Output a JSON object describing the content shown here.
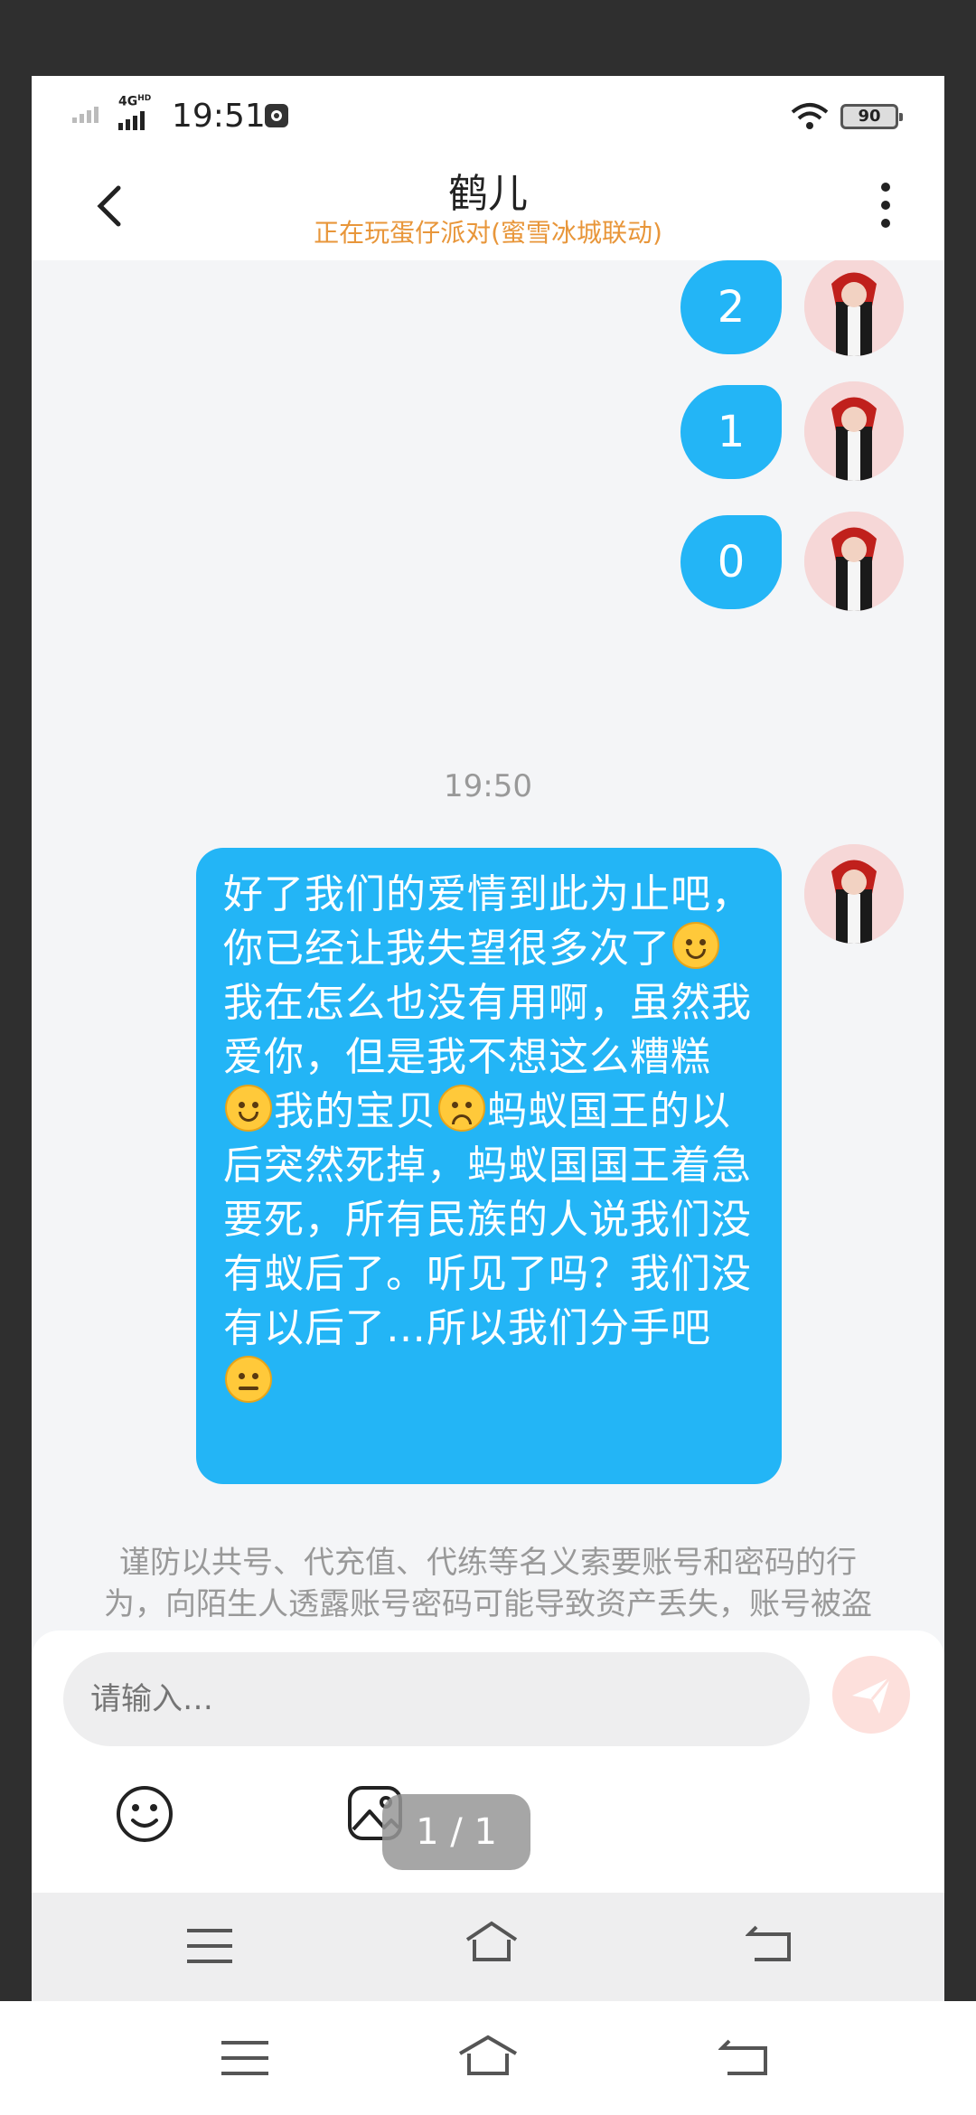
{
  "status_bar": {
    "network": "4G",
    "network_sub": "HD",
    "time": "19:51",
    "battery": "90"
  },
  "header": {
    "title": "鹤儿",
    "subtitle": "正在玩蛋仔派对(蜜雪冰城联动)"
  },
  "messages": {
    "count_msgs": [
      "2",
      "1",
      "0"
    ],
    "time_label": "19:50",
    "long_message_parts": [
      "好了我们的爱情到此为止吧，你已经让我失望很多次了",
      "我在怎么也没有用啊，虽然我爱你，但是我不想这么糟糕",
      "我的宝贝",
      "蚂蚁国王的以后突然死掉，蚂蚁国国王着急要死，所有民族的人说我们没有蚁后了。听见了吗？我们没有以后了…所以我们分手吧"
    ],
    "emojis": [
      "smile-emoji",
      "smile-emoji",
      "sad-emoji",
      "neutral-emoji"
    ]
  },
  "warning": "谨防以共号、代充值、代练等名义索要账号和密码的行为，向陌生人透露账号密码可能导致资产丢失，账号被盗",
  "input": {
    "placeholder": "请输入…"
  },
  "pager": "1 / 1",
  "colors": {
    "accent_blue": "#23b5f6",
    "subtitle_orange": "#e8963a",
    "send_button_bg": "#fde0dc"
  }
}
